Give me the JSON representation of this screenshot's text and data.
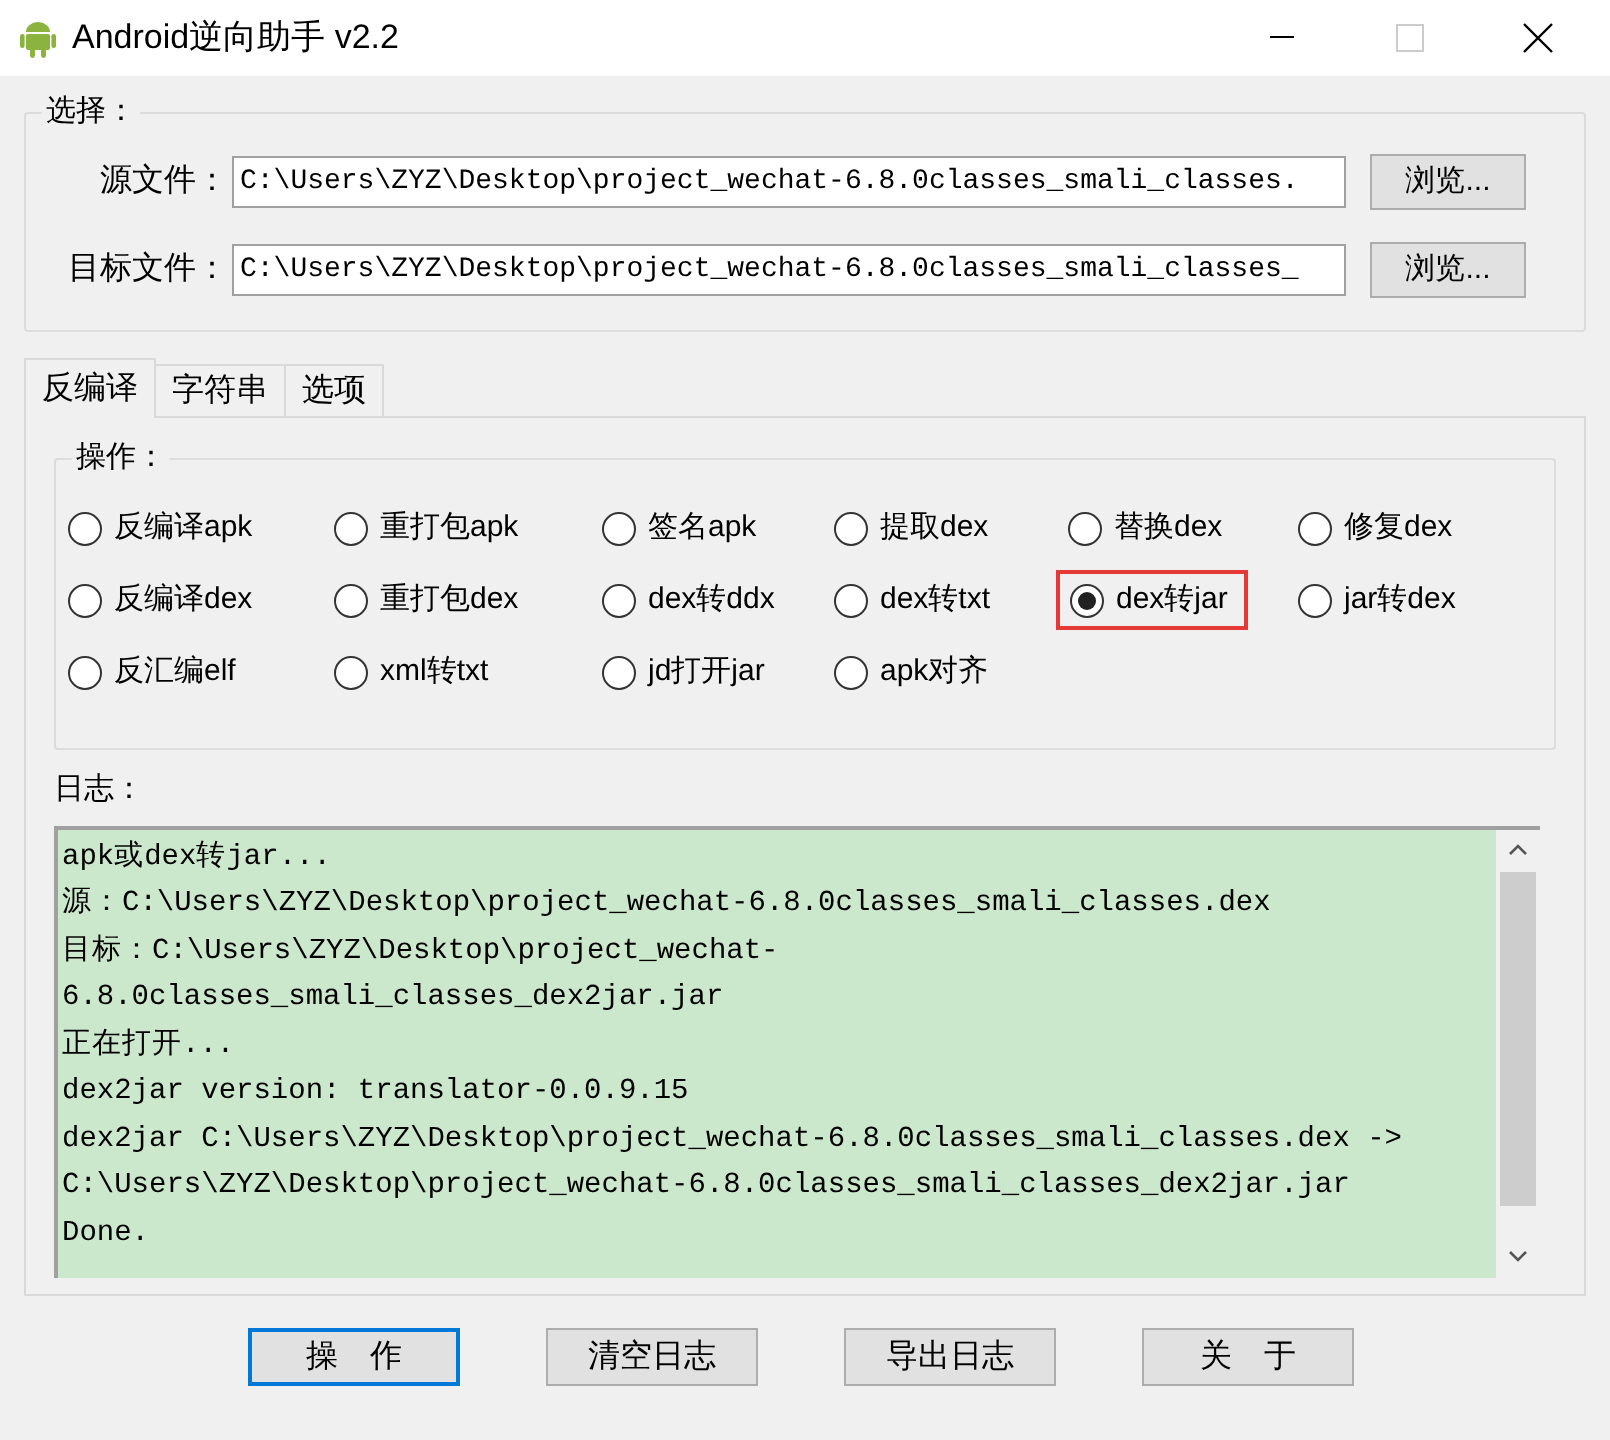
{
  "window": {
    "title": "Android逆向助手 v2.2"
  },
  "select_group": {
    "title": "选择：",
    "fields": [
      {
        "label": "源文件：",
        "value": "C:\\Users\\ZYZ\\Desktop\\project_wechat-6.8.0classes_smali_classes.",
        "button": "浏览..."
      },
      {
        "label": "目标文件：",
        "value": "C:\\Users\\ZYZ\\Desktop\\project_wechat-6.8.0classes_smali_classes_",
        "button": "浏览..."
      }
    ]
  },
  "tabs": [
    {
      "label": "反编译",
      "selected": true
    },
    {
      "label": "字符串",
      "selected": false
    },
    {
      "label": "选项",
      "selected": false
    }
  ],
  "operations": {
    "title": "操作：",
    "options": [
      {
        "label": "反编译apk",
        "selected": false,
        "highlighted": false
      },
      {
        "label": "重打包apk",
        "selected": false,
        "highlighted": false
      },
      {
        "label": "签名apk",
        "selected": false,
        "highlighted": false
      },
      {
        "label": "提取dex",
        "selected": false,
        "highlighted": false
      },
      {
        "label": "替换dex",
        "selected": false,
        "highlighted": false
      },
      {
        "label": "修复dex",
        "selected": false,
        "highlighted": false
      },
      {
        "label": "反编译dex",
        "selected": false,
        "highlighted": false
      },
      {
        "label": "重打包dex",
        "selected": false,
        "highlighted": false
      },
      {
        "label": "dex转ddx",
        "selected": false,
        "highlighted": false
      },
      {
        "label": "dex转txt",
        "selected": false,
        "highlighted": false
      },
      {
        "label": "dex转jar",
        "selected": true,
        "highlighted": true
      },
      {
        "label": "jar转dex",
        "selected": false,
        "highlighted": false
      },
      {
        "label": "反汇编elf",
        "selected": false,
        "highlighted": false
      },
      {
        "label": "xml转txt",
        "selected": false,
        "highlighted": false
      },
      {
        "label": "jd打开jar",
        "selected": false,
        "highlighted": false
      },
      {
        "label": "apk对齐",
        "selected": false,
        "highlighted": false
      }
    ]
  },
  "log": {
    "title": "日志：",
    "lines": [
      "apk或dex转jar...",
      "源：C:\\Users\\ZYZ\\Desktop\\project_wechat-6.8.0classes_smali_classes.dex",
      "目标：C:\\Users\\ZYZ\\Desktop\\project_wechat-",
      "6.8.0classes_smali_classes_dex2jar.jar",
      "正在打开...",
      "dex2jar version: translator-0.0.9.15",
      "dex2jar C:\\Users\\ZYZ\\Desktop\\project_wechat-6.8.0classes_smali_classes.dex ->",
      "C:\\Users\\ZYZ\\Desktop\\project_wechat-6.8.0classes_smali_classes_dex2jar.jar",
      "Done."
    ]
  },
  "buttons": [
    {
      "label": "操　作",
      "default": true
    },
    {
      "label": "清空日志",
      "default": false
    },
    {
      "label": "导出日志",
      "default": false
    },
    {
      "label": "关　于",
      "default": false
    }
  ]
}
